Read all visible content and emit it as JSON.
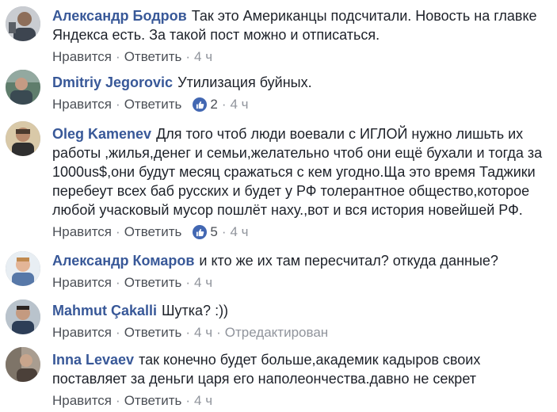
{
  "comments": [
    {
      "author": "Александр Бодров",
      "text": "Так это Американцы подсчитали. Новость на главке Яндекса есть. За такой пост можно и отписаться.",
      "like": "Нравится",
      "reply": "Ответить",
      "likes": "",
      "time": "4 ч",
      "edited": ""
    },
    {
      "author": "Dmitriy Jegorovic",
      "text": "Утилизация буйных.",
      "like": "Нравится",
      "reply": "Ответить",
      "likes": "2",
      "time": "4 ч",
      "edited": ""
    },
    {
      "author": "Oleg Kamenev",
      "text": "Для того чтоб люди воевали с ИГЛОЙ нужно лишьть их работы ,жилья,денег и семьи,желательно чтоб они ещё бухали и тогда за 1000us$,они будут месяц сражаться с кем угодно.Ща это время Таджики перебеут всех баб русских и будет у РФ толерантное общество,которое любой учасковый мусор пошлёт наху.,вот и вся история новейшей РФ.",
      "like": "Нравится",
      "reply": "Ответить",
      "likes": "5",
      "time": "4 ч",
      "edited": ""
    },
    {
      "author": "Александр Комаров",
      "text": "и кто же их там пересчитал? откуда данные?",
      "like": "Нравится",
      "reply": "Ответить",
      "likes": "",
      "time": "4 ч",
      "edited": ""
    },
    {
      "author": "Mahmut Çakalli",
      "text": "Шутка? :))",
      "like": "Нравится",
      "reply": "Ответить",
      "likes": "",
      "time": "4 ч",
      "edited": "Отредактирован"
    },
    {
      "author": "Inna Levaev",
      "text": "так конечно будет больше,академик кадыров своих поставляет за деньги царя его наполеончества.давно не секрет",
      "like": "Нравится",
      "reply": "Ответить",
      "likes": "",
      "time": "4 ч",
      "edited": ""
    }
  ]
}
